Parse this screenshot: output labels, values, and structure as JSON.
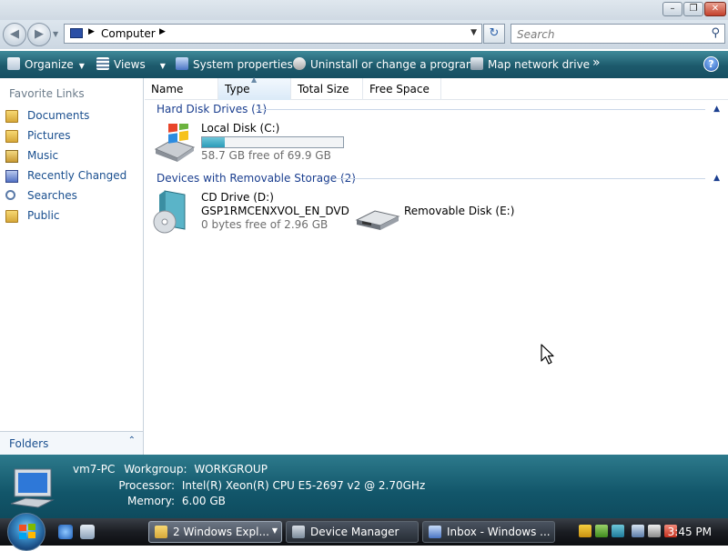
{
  "window": {
    "minimize_glyph": "–",
    "maximize_glyph": "❐",
    "close_glyph": "✕"
  },
  "address": {
    "back_glyph": "◀",
    "forward_glyph": "▶",
    "separator_glyph": "▶",
    "location": "Computer",
    "dropdown_glyph": "▼",
    "refresh_glyph": "↻",
    "search_placeholder": "Search",
    "search_glyph": "⚲"
  },
  "commands": {
    "organize": "Organize",
    "views": "Views",
    "system_properties": "System properties",
    "uninstall": "Uninstall or change a program",
    "map_drive": "Map network drive",
    "more": "»",
    "help": "?"
  },
  "nav": {
    "favorite_links_title": "Favorite Links",
    "items": [
      {
        "label": "Documents",
        "icon": "documents-folder-icon"
      },
      {
        "label": "Pictures",
        "icon": "pictures-folder-icon"
      },
      {
        "label": "Music",
        "icon": "music-folder-icon"
      },
      {
        "label": "Recently Changed",
        "icon": "recently-changed-icon"
      },
      {
        "label": "Searches",
        "icon": "searches-icon"
      },
      {
        "label": "Public",
        "icon": "public-folder-icon"
      }
    ],
    "folders_label": "Folders",
    "folders_chevron": "⌃"
  },
  "columns": [
    "Name",
    "Type",
    "Total Size",
    "Free Space"
  ],
  "groups": {
    "hard_disk": {
      "title": "Hard Disk Drives (1)",
      "chevron": "▲",
      "drives": [
        {
          "name": "Local Disk (C:)",
          "free_text": "58.7 GB free of 69.9 GB",
          "used_fraction": 0.16
        }
      ]
    },
    "removable": {
      "title": "Devices with Removable Storage (2)",
      "chevron": "▲",
      "cd": {
        "name": "CD Drive (D:)",
        "label": "GSP1RMCENXVOL_EN_DVD",
        "free_text": "0 bytes free of 2.96 GB"
      },
      "removable": {
        "name": "Removable Disk (E:)"
      }
    }
  },
  "details": {
    "computer_name": "vm7-PC",
    "workgroup_label": "Workgroup:",
    "workgroup_value": "WORKGROUP",
    "processor_label": "Processor:",
    "processor_value": "Intel(R) Xeon(R) CPU E5-2697 v2 @ 2.70GHz",
    "memory_label": "Memory:",
    "memory_value": "6.00 GB"
  },
  "taskbar": {
    "buttons": [
      {
        "label": "2 Windows Expl...",
        "active": true
      },
      {
        "label": "Device Manager",
        "active": false
      },
      {
        "label": "Inbox - Windows ...",
        "active": false
      }
    ],
    "dropdown_glyph": "▼",
    "clock": "3:45 PM"
  }
}
